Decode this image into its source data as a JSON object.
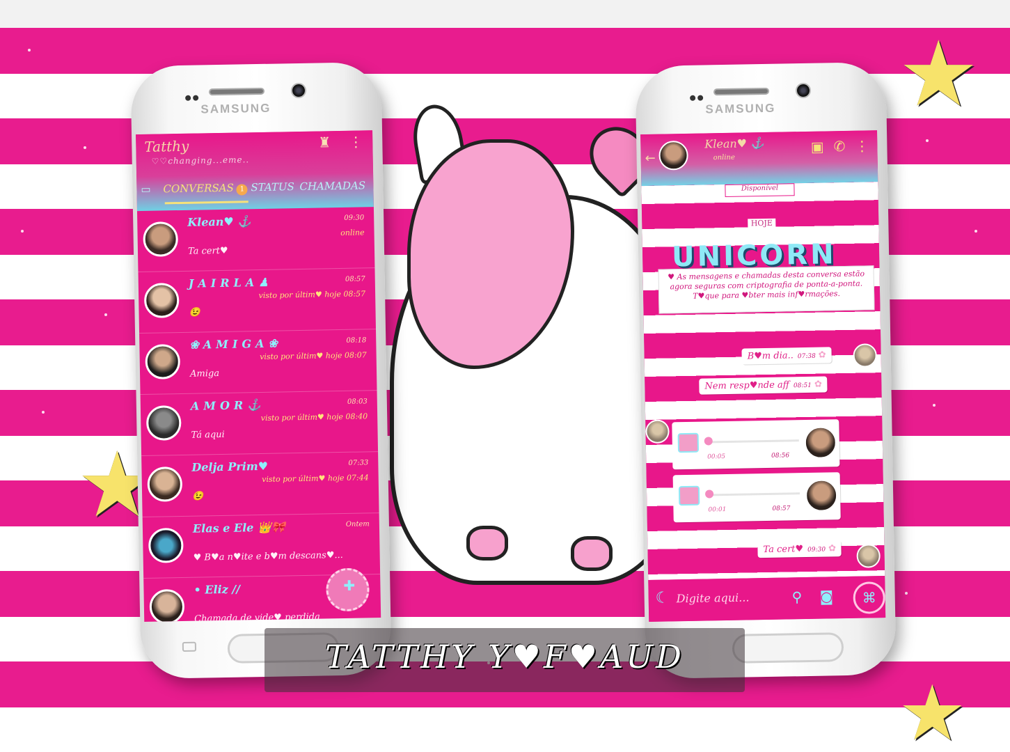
{
  "left_phone": {
    "brand": "SAMSUNG",
    "header": {
      "title": "Tatthy",
      "subtitle": "♡♡changing...eme..",
      "tabs": [
        {
          "label": "CONVERSAS",
          "badge": "1"
        },
        {
          "label": "STATUS"
        },
        {
          "label": "CHAMADAS"
        }
      ]
    },
    "chats": [
      {
        "name": "Klean♥ ⚓",
        "time": "09:30",
        "status": "online",
        "message": "Ta cert♥"
      },
      {
        "name": "JAIRLA♟",
        "time": "08:57",
        "status": "visto por últim♥ hoje 08:57",
        "message": "😉"
      },
      {
        "name": "❀AMIGA❀",
        "time": "08:18",
        "status": "visto por últim♥ hoje 08:07",
        "message": "Amiga"
      },
      {
        "name": "AMOR⚓",
        "time": "08:03",
        "status": "visto por últim♥ hoje 08:40",
        "message": "Tá aqui"
      },
      {
        "name": "Delja Prim♥",
        "time": "07:33",
        "status": "visto por últim♥ hoje 07:44",
        "message": "😉"
      },
      {
        "name": "Elas e Ele 👑🎀",
        "time": "Ontem",
        "status": "",
        "message": "♥ B♥a n♥ite e b♥m descans♥..."
      },
      {
        "name": "• Eliz //",
        "time": "",
        "status": "",
        "message": "Chamada de vide♥ perdida"
      }
    ],
    "fab_label": "✚"
  },
  "right_phone": {
    "brand": "SAMSUNG",
    "header": {
      "name": "Klean♥ ⚓",
      "status": "online"
    },
    "status_tag": "Disponível",
    "day_label": "HOJE",
    "banner": "UNICORN",
    "encryption_notice": "♥ As mensagens e chamadas desta conversa estão agora seguras com criptografia de ponta-a-ponta. T♥que para ♥bter mais inf♥rmações.",
    "messages": [
      {
        "text": "B♥m dia..",
        "time": "07:38"
      },
      {
        "text": "Nem resp♥nde aff",
        "time": "08:51"
      }
    ],
    "audios": [
      {
        "duration": "00:05",
        "time": "08:56"
      },
      {
        "duration": "00:01",
        "time": "08:57"
      }
    ],
    "last_message": {
      "text": "Ta cert♥",
      "time": "09:30"
    },
    "input_placeholder": "Digite aqui..."
  },
  "signature": "TATTHY Y♥F♥AUD",
  "colors": {
    "accent_pink": "#e8178a",
    "accent_cyan": "#8ff0fb",
    "accent_yellow": "#f6e27a"
  },
  "icons": [
    "moon-icon",
    "attach-icon",
    "camera-icon",
    "send-icon",
    "video-call-icon",
    "phone-call-icon",
    "more-icon",
    "eiffel-icon",
    "back-arrow-icon"
  ]
}
